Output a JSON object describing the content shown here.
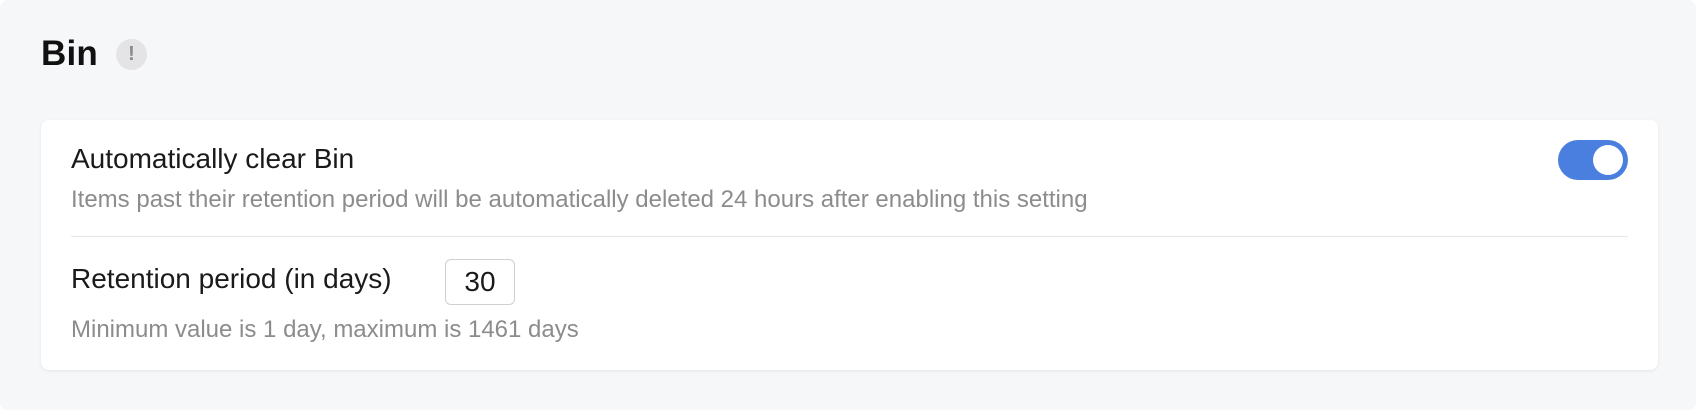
{
  "section": {
    "title": "Bin",
    "info_icon": "exclamation-icon",
    "info_glyph": "!"
  },
  "auto_clear": {
    "label": "Automatically clear Bin",
    "description": "Items past their retention period will be automatically deleted 24 hours after enabling this setting",
    "enabled": true,
    "toggle_color": "#4a7fe0"
  },
  "retention": {
    "label": "Retention period (in days)",
    "value": "30",
    "hint": "Minimum value is 1 day, maximum is 1461 days"
  }
}
